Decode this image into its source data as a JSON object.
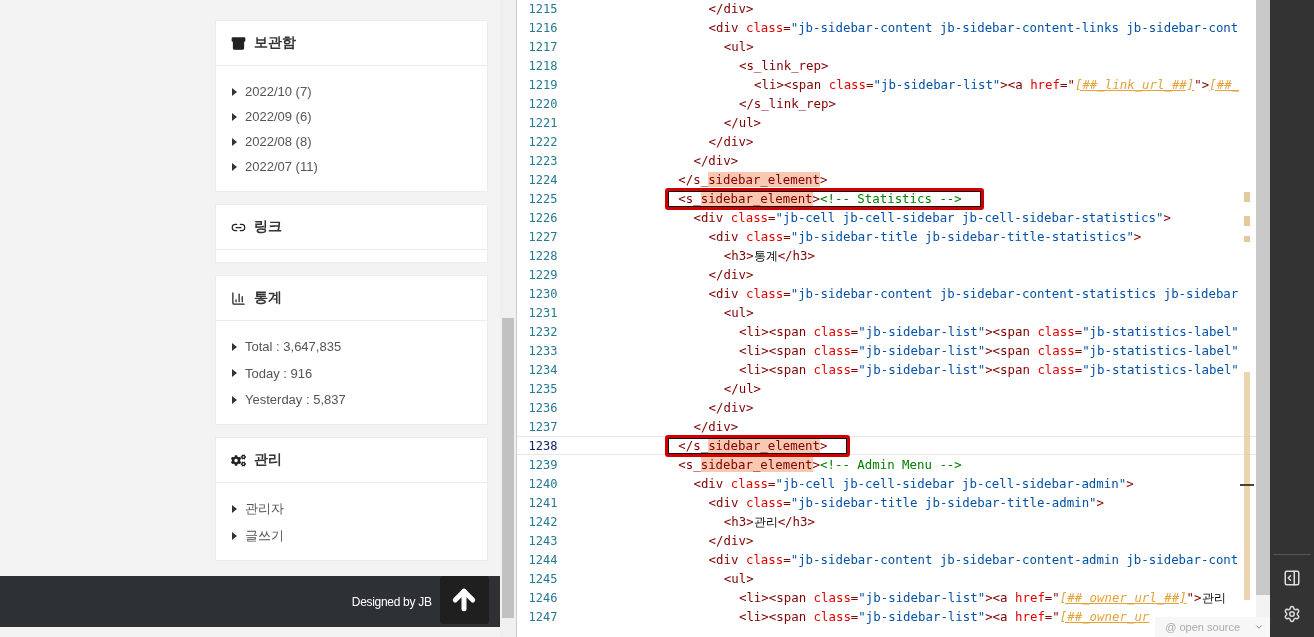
{
  "sidebar": {
    "cards": [
      {
        "kind": "archive",
        "title": "보관함",
        "items": [
          "2022/10 (7)",
          "2022/09 (6)",
          "2022/08 (8)",
          "2022/07 (11)"
        ]
      },
      {
        "kind": "links",
        "title": "링크"
      },
      {
        "kind": "stats",
        "title": "통계",
        "items": [
          "Total : 3,647,835",
          "Today : 916",
          "Yesterday : 5,837"
        ]
      },
      {
        "kind": "admin",
        "title": "관리",
        "items": [
          "관리자",
          "글쓰기"
        ]
      }
    ]
  },
  "footer": {
    "text": "Designed by JB"
  },
  "editor": {
    "lines": [
      {
        "number": "1215",
        "current": false,
        "boxed": false,
        "tokens": [
          {
            "kind": "punct",
            "text": "            </"
          },
          {
            "kind": "tag",
            "text": "div"
          },
          {
            "kind": "punct",
            "text": ">"
          }
        ]
      },
      {
        "number": "1216",
        "current": false,
        "boxed": false,
        "tokens": [
          {
            "kind": "punct",
            "text": "            <"
          },
          {
            "kind": "tag",
            "text": "div"
          },
          {
            "kind": "attr",
            "text": " class"
          },
          {
            "kind": "punct",
            "text": "="
          },
          {
            "kind": "value",
            "text": "\"jb-sidebar-content jb-sidebar-content-links jb-sidebar-cont"
          }
        ]
      },
      {
        "number": "1217",
        "current": false,
        "boxed": false,
        "tokens": [
          {
            "kind": "punct",
            "text": "              <"
          },
          {
            "kind": "tag",
            "text": "ul"
          },
          {
            "kind": "punct",
            "text": ">"
          }
        ]
      },
      {
        "number": "1218",
        "current": false,
        "boxed": false,
        "tokens": [
          {
            "kind": "punct",
            "text": "                <"
          },
          {
            "kind": "tag",
            "text": "s_link_rep"
          },
          {
            "kind": "punct",
            "text": ">"
          }
        ]
      },
      {
        "number": "1219",
        "current": false,
        "boxed": false,
        "tokens": [
          {
            "kind": "punct",
            "text": "                  <"
          },
          {
            "kind": "tag",
            "text": "li"
          },
          {
            "kind": "punct",
            "text": "><"
          },
          {
            "kind": "tag",
            "text": "span"
          },
          {
            "kind": "attr",
            "text": " class"
          },
          {
            "kind": "punct",
            "text": "="
          },
          {
            "kind": "value",
            "text": "\"jb-sidebar-list\""
          },
          {
            "kind": "punct",
            "text": "><"
          },
          {
            "kind": "tag",
            "text": "a"
          },
          {
            "kind": "attr",
            "text": " href"
          },
          {
            "kind": "punct",
            "text": "=\""
          },
          {
            "kind": "template",
            "text": "[##_link_url_##]"
          },
          {
            "kind": "punct",
            "text": "\">"
          },
          {
            "kind": "template",
            "text": "[##_"
          }
        ]
      },
      {
        "number": "1220",
        "current": false,
        "boxed": false,
        "tokens": [
          {
            "kind": "punct",
            "text": "                </"
          },
          {
            "kind": "tag",
            "text": "s_link_rep"
          },
          {
            "kind": "punct",
            "text": ">"
          }
        ]
      },
      {
        "number": "1221",
        "current": false,
        "boxed": false,
        "tokens": [
          {
            "kind": "punct",
            "text": "              </"
          },
          {
            "kind": "tag",
            "text": "ul"
          },
          {
            "kind": "punct",
            "text": ">"
          }
        ]
      },
      {
        "number": "1222",
        "current": false,
        "boxed": false,
        "tokens": [
          {
            "kind": "punct",
            "text": "            </"
          },
          {
            "kind": "tag",
            "text": "div"
          },
          {
            "kind": "punct",
            "text": ">"
          }
        ]
      },
      {
        "number": "1223",
        "current": false,
        "boxed": false,
        "tokens": [
          {
            "kind": "punct",
            "text": "          </"
          },
          {
            "kind": "tag",
            "text": "div"
          },
          {
            "kind": "punct",
            "text": ">"
          }
        ]
      },
      {
        "number": "1224",
        "current": false,
        "boxed": false,
        "tokens": [
          {
            "kind": "punct",
            "text": "        </"
          },
          {
            "kind": "tag",
            "text": "s_"
          },
          {
            "kind": "match",
            "text": "sidebar_element"
          },
          {
            "kind": "punct",
            "text": ">"
          }
        ]
      },
      {
        "number": "1225",
        "current": false,
        "boxed": true,
        "tokens": [
          {
            "kind": "punct",
            "text": "        <"
          },
          {
            "kind": "tag",
            "text": "s_"
          },
          {
            "kind": "match",
            "text": "sidebar_element"
          },
          {
            "kind": "punct",
            "text": ">"
          },
          {
            "kind": "comment",
            "text": "<!-- Statistics -->"
          }
        ]
      },
      {
        "number": "1226",
        "current": false,
        "boxed": false,
        "tokens": [
          {
            "kind": "punct",
            "text": "          <"
          },
          {
            "kind": "tag",
            "text": "div"
          },
          {
            "kind": "attr",
            "text": " class"
          },
          {
            "kind": "punct",
            "text": "="
          },
          {
            "kind": "value",
            "text": "\"jb-cell jb-cell-sidebar jb-cell-sidebar-statistics\""
          },
          {
            "kind": "punct",
            "text": ">"
          }
        ]
      },
      {
        "number": "1227",
        "current": false,
        "boxed": false,
        "tokens": [
          {
            "kind": "punct",
            "text": "            <"
          },
          {
            "kind": "tag",
            "text": "div"
          },
          {
            "kind": "attr",
            "text": " class"
          },
          {
            "kind": "punct",
            "text": "="
          },
          {
            "kind": "value",
            "text": "\"jb-sidebar-title jb-sidebar-title-statistics\""
          },
          {
            "kind": "punct",
            "text": ">"
          }
        ]
      },
      {
        "number": "1228",
        "current": false,
        "boxed": false,
        "tokens": [
          {
            "kind": "punct",
            "text": "              <"
          },
          {
            "kind": "tag",
            "text": "h3"
          },
          {
            "kind": "punct",
            "text": ">"
          },
          {
            "kind": "text",
            "text": "통계"
          },
          {
            "kind": "punct",
            "text": "</"
          },
          {
            "kind": "tag",
            "text": "h3"
          },
          {
            "kind": "punct",
            "text": ">"
          }
        ]
      },
      {
        "number": "1229",
        "current": false,
        "boxed": false,
        "tokens": [
          {
            "kind": "punct",
            "text": "            </"
          },
          {
            "kind": "tag",
            "text": "div"
          },
          {
            "kind": "punct",
            "text": ">"
          }
        ]
      },
      {
        "number": "1230",
        "current": false,
        "boxed": false,
        "tokens": [
          {
            "kind": "punct",
            "text": "            <"
          },
          {
            "kind": "tag",
            "text": "div"
          },
          {
            "kind": "attr",
            "text": " class"
          },
          {
            "kind": "punct",
            "text": "="
          },
          {
            "kind": "value",
            "text": "\"jb-sidebar-content jb-sidebar-content-statistics jb-sidebar"
          }
        ]
      },
      {
        "number": "1231",
        "current": false,
        "boxed": false,
        "tokens": [
          {
            "kind": "punct",
            "text": "              <"
          },
          {
            "kind": "tag",
            "text": "ul"
          },
          {
            "kind": "punct",
            "text": ">"
          }
        ]
      },
      {
        "number": "1232",
        "current": false,
        "boxed": false,
        "tokens": [
          {
            "kind": "punct",
            "text": "                <"
          },
          {
            "kind": "tag",
            "text": "li"
          },
          {
            "kind": "punct",
            "text": "><"
          },
          {
            "kind": "tag",
            "text": "span"
          },
          {
            "kind": "attr",
            "text": " class"
          },
          {
            "kind": "punct",
            "text": "="
          },
          {
            "kind": "value",
            "text": "\"jb-sidebar-list\""
          },
          {
            "kind": "punct",
            "text": "><"
          },
          {
            "kind": "tag",
            "text": "span"
          },
          {
            "kind": "attr",
            "text": " class"
          },
          {
            "kind": "punct",
            "text": "="
          },
          {
            "kind": "value",
            "text": "\"jb-statistics-label\""
          }
        ]
      },
      {
        "number": "1233",
        "current": false,
        "boxed": false,
        "tokens": [
          {
            "kind": "punct",
            "text": "                <"
          },
          {
            "kind": "tag",
            "text": "li"
          },
          {
            "kind": "punct",
            "text": "><"
          },
          {
            "kind": "tag",
            "text": "span"
          },
          {
            "kind": "attr",
            "text": " class"
          },
          {
            "kind": "punct",
            "text": "="
          },
          {
            "kind": "value",
            "text": "\"jb-sidebar-list\""
          },
          {
            "kind": "punct",
            "text": "><"
          },
          {
            "kind": "tag",
            "text": "span"
          },
          {
            "kind": "attr",
            "text": " class"
          },
          {
            "kind": "punct",
            "text": "="
          },
          {
            "kind": "value",
            "text": "\"jb-statistics-label\""
          }
        ]
      },
      {
        "number": "1234",
        "current": false,
        "boxed": false,
        "tokens": [
          {
            "kind": "punct",
            "text": "                <"
          },
          {
            "kind": "tag",
            "text": "li"
          },
          {
            "kind": "punct",
            "text": "><"
          },
          {
            "kind": "tag",
            "text": "span"
          },
          {
            "kind": "attr",
            "text": " class"
          },
          {
            "kind": "punct",
            "text": "="
          },
          {
            "kind": "value",
            "text": "\"jb-sidebar-list\""
          },
          {
            "kind": "punct",
            "text": "><"
          },
          {
            "kind": "tag",
            "text": "span"
          },
          {
            "kind": "attr",
            "text": " class"
          },
          {
            "kind": "punct",
            "text": "="
          },
          {
            "kind": "value",
            "text": "\"jb-statistics-label\""
          }
        ]
      },
      {
        "number": "1235",
        "current": false,
        "boxed": false,
        "tokens": [
          {
            "kind": "punct",
            "text": "              </"
          },
          {
            "kind": "tag",
            "text": "ul"
          },
          {
            "kind": "punct",
            "text": ">"
          }
        ]
      },
      {
        "number": "1236",
        "current": false,
        "boxed": false,
        "tokens": [
          {
            "kind": "punct",
            "text": "            </"
          },
          {
            "kind": "tag",
            "text": "div"
          },
          {
            "kind": "punct",
            "text": ">"
          }
        ]
      },
      {
        "number": "1237",
        "current": false,
        "boxed": false,
        "tokens": [
          {
            "kind": "punct",
            "text": "          </"
          },
          {
            "kind": "tag",
            "text": "div"
          },
          {
            "kind": "punct",
            "text": ">"
          }
        ]
      },
      {
        "number": "1238",
        "current": true,
        "boxed": true,
        "tokens": [
          {
            "kind": "punct",
            "text": "        </"
          },
          {
            "kind": "tag",
            "text": "s_"
          },
          {
            "kind": "match",
            "text": "sidebar_element"
          },
          {
            "kind": "punct",
            "text": ">"
          }
        ]
      },
      {
        "number": "1239",
        "current": false,
        "boxed": false,
        "tokens": [
          {
            "kind": "punct",
            "text": "        <"
          },
          {
            "kind": "tag",
            "text": "s_"
          },
          {
            "kind": "match",
            "text": "sidebar_element"
          },
          {
            "kind": "punct",
            "text": ">"
          },
          {
            "kind": "comment",
            "text": "<!-- Admin Menu -->"
          }
        ]
      },
      {
        "number": "1240",
        "current": false,
        "boxed": false,
        "tokens": [
          {
            "kind": "punct",
            "text": "          <"
          },
          {
            "kind": "tag",
            "text": "div"
          },
          {
            "kind": "attr",
            "text": " class"
          },
          {
            "kind": "punct",
            "text": "="
          },
          {
            "kind": "value",
            "text": "\"jb-cell jb-cell-sidebar jb-cell-sidebar-admin\""
          },
          {
            "kind": "punct",
            "text": ">"
          }
        ]
      },
      {
        "number": "1241",
        "current": false,
        "boxed": false,
        "tokens": [
          {
            "kind": "punct",
            "text": "            <"
          },
          {
            "kind": "tag",
            "text": "div"
          },
          {
            "kind": "attr",
            "text": " class"
          },
          {
            "kind": "punct",
            "text": "="
          },
          {
            "kind": "value",
            "text": "\"jb-sidebar-title jb-sidebar-title-admin\""
          },
          {
            "kind": "punct",
            "text": ">"
          }
        ]
      },
      {
        "number": "1242",
        "current": false,
        "boxed": false,
        "tokens": [
          {
            "kind": "punct",
            "text": "              <"
          },
          {
            "kind": "tag",
            "text": "h3"
          },
          {
            "kind": "punct",
            "text": ">"
          },
          {
            "kind": "text",
            "text": "관리"
          },
          {
            "kind": "punct",
            "text": "</"
          },
          {
            "kind": "tag",
            "text": "h3"
          },
          {
            "kind": "punct",
            "text": ">"
          }
        ]
      },
      {
        "number": "1243",
        "current": false,
        "boxed": false,
        "tokens": [
          {
            "kind": "punct",
            "text": "            </"
          },
          {
            "kind": "tag",
            "text": "div"
          },
          {
            "kind": "punct",
            "text": ">"
          }
        ]
      },
      {
        "number": "1244",
        "current": false,
        "boxed": false,
        "tokens": [
          {
            "kind": "punct",
            "text": "            <"
          },
          {
            "kind": "tag",
            "text": "div"
          },
          {
            "kind": "attr",
            "text": " class"
          },
          {
            "kind": "punct",
            "text": "="
          },
          {
            "kind": "value",
            "text": "\"jb-sidebar-content jb-sidebar-content-admin jb-sidebar-cont"
          }
        ]
      },
      {
        "number": "1245",
        "current": false,
        "boxed": false,
        "tokens": [
          {
            "kind": "punct",
            "text": "              <"
          },
          {
            "kind": "tag",
            "text": "ul"
          },
          {
            "kind": "punct",
            "text": ">"
          }
        ]
      },
      {
        "number": "1246",
        "current": false,
        "boxed": false,
        "tokens": [
          {
            "kind": "punct",
            "text": "                <"
          },
          {
            "kind": "tag",
            "text": "li"
          },
          {
            "kind": "punct",
            "text": "><"
          },
          {
            "kind": "tag",
            "text": "span"
          },
          {
            "kind": "attr",
            "text": " class"
          },
          {
            "kind": "punct",
            "text": "="
          },
          {
            "kind": "value",
            "text": "\"jb-sidebar-list\""
          },
          {
            "kind": "punct",
            "text": "><"
          },
          {
            "kind": "tag",
            "text": "a"
          },
          {
            "kind": "attr",
            "text": " href"
          },
          {
            "kind": "punct",
            "text": "=\""
          },
          {
            "kind": "template",
            "text": "[##_owner_url_##]"
          },
          {
            "kind": "punct",
            "text": "\">"
          },
          {
            "kind": "text",
            "text": "관리"
          }
        ]
      },
      {
        "number": "1247",
        "current": false,
        "boxed": false,
        "tokens": [
          {
            "kind": "punct",
            "text": "                <"
          },
          {
            "kind": "tag",
            "text": "li"
          },
          {
            "kind": "punct",
            "text": "><"
          },
          {
            "kind": "tag",
            "text": "span"
          },
          {
            "kind": "attr",
            "text": " class"
          },
          {
            "kind": "punct",
            "text": "="
          },
          {
            "kind": "value",
            "text": "\"jb-sidebar-list\""
          },
          {
            "kind": "punct",
            "text": "><"
          },
          {
            "kind": "tag",
            "text": "a"
          },
          {
            "kind": "attr",
            "text": " href"
          },
          {
            "kind": "punct",
            "text": "=\""
          },
          {
            "kind": "template",
            "text": "[##_owner_ur"
          }
        ]
      }
    ],
    "badge": "@ open source"
  }
}
